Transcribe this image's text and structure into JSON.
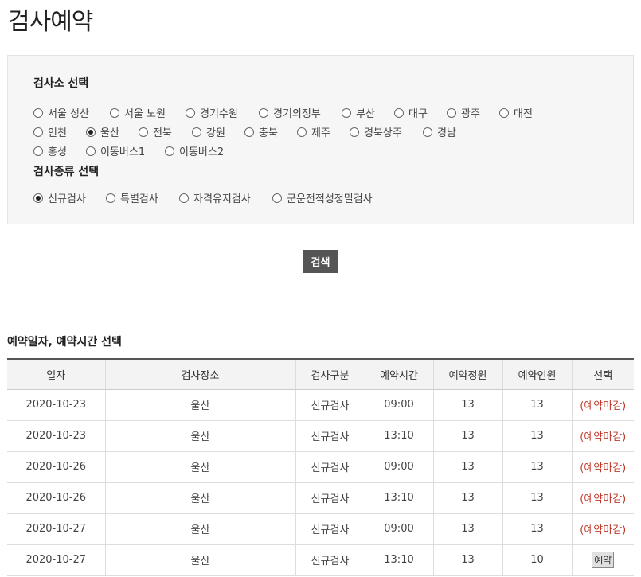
{
  "page": {
    "title": "검사예약"
  },
  "filters": {
    "center_label": "검사소 선택",
    "centers": [
      {
        "label": "서울 성산",
        "checked": false
      },
      {
        "label": "서울 노원",
        "checked": false
      },
      {
        "label": "경기수원",
        "checked": false
      },
      {
        "label": "경기의정부",
        "checked": false
      },
      {
        "label": "부산",
        "checked": false
      },
      {
        "label": "대구",
        "checked": false
      },
      {
        "label": "광주",
        "checked": false
      },
      {
        "label": "대전",
        "checked": false
      },
      {
        "label": "인천",
        "checked": false
      },
      {
        "label": "울산",
        "checked": true
      },
      {
        "label": "전북",
        "checked": false
      },
      {
        "label": "강원",
        "checked": false
      },
      {
        "label": "충북",
        "checked": false
      },
      {
        "label": "제주",
        "checked": false
      },
      {
        "label": "경북상주",
        "checked": false
      },
      {
        "label": "경남",
        "checked": false
      },
      {
        "label": "홍성",
        "checked": false
      },
      {
        "label": "이동버스1",
        "checked": false
      },
      {
        "label": "이동버스2",
        "checked": false
      }
    ],
    "type_label": "검사종류 선택",
    "types": [
      {
        "label": "신규검사",
        "checked": true
      },
      {
        "label": "특별검사",
        "checked": false
      },
      {
        "label": "자격유지검사",
        "checked": false
      },
      {
        "label": "군운전적성정밀검사",
        "checked": false
      }
    ]
  },
  "search_button": "검색",
  "results": {
    "title": "예약일자, 예약시간 선택",
    "headers": [
      "일자",
      "검사장소",
      "검사구분",
      "예약시간",
      "예약정원",
      "예약인원",
      "선택"
    ],
    "rows": [
      {
        "date": "2020-10-23",
        "place": "울산",
        "category": "신규검사",
        "time": "09:00",
        "capacity": "13",
        "reserved": "13",
        "action": "(예약마감)"
      },
      {
        "date": "2020-10-23",
        "place": "울산",
        "category": "신규검사",
        "time": "13:10",
        "capacity": "13",
        "reserved": "13",
        "action": "(예약마감)"
      },
      {
        "date": "2020-10-26",
        "place": "울산",
        "category": "신규검사",
        "time": "09:00",
        "capacity": "13",
        "reserved": "13",
        "action": "(예약마감)"
      },
      {
        "date": "2020-10-26",
        "place": "울산",
        "category": "신규검사",
        "time": "13:10",
        "capacity": "13",
        "reserved": "13",
        "action": "(예약마감)"
      },
      {
        "date": "2020-10-27",
        "place": "울산",
        "category": "신규검사",
        "time": "09:00",
        "capacity": "13",
        "reserved": "13",
        "action": "(예약마감)"
      },
      {
        "date": "2020-10-27",
        "place": "울산",
        "category": "신규검사",
        "time": "13:10",
        "capacity": "13",
        "reserved": "10",
        "action": "예약"
      }
    ]
  }
}
